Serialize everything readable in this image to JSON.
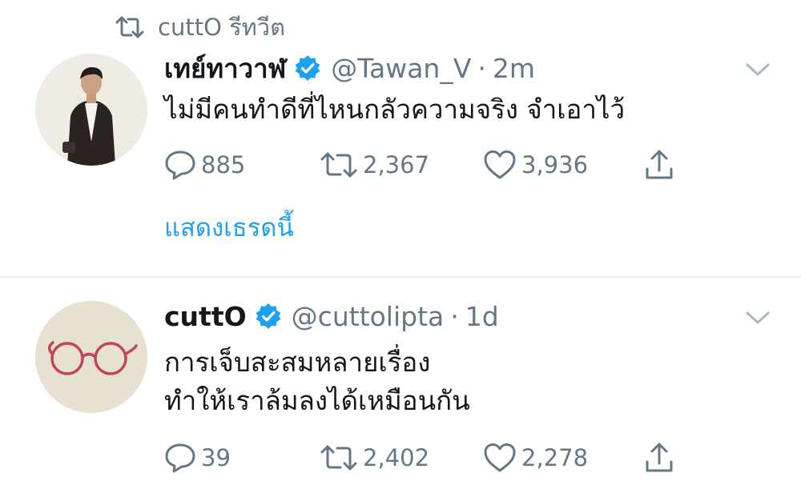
{
  "retweet_context": {
    "text": "cuttO รีทวีต",
    "icon": "retweet-icon"
  },
  "tweets": [
    {
      "author_name": "เทย์ทาวาฬ",
      "handle": "@Tawan_V",
      "time": "2m",
      "verified": true,
      "text_lines": [
        "ไม่มีคนทำดีที่ไหนกลัวความจริง จำเอาไว้"
      ],
      "replies": "885",
      "retweets": "2,367",
      "likes": "3,936",
      "show_thread": "แสดงเธรดนี้"
    },
    {
      "author_name": "cuttO",
      "handle": "@cuttolipta",
      "time": "1d",
      "verified": true,
      "text_lines": [
        "การเจ็บสะสมหลายเรื่อง",
        "ทำให้เราล้มลงได้เหมือนกัน"
      ],
      "replies": "39",
      "retweets": "2,402",
      "likes": "2,278"
    }
  ],
  "colors": {
    "accent": "#1da1f2",
    "muted": "#657786",
    "text": "#14171a",
    "divider": "#e6ecf0",
    "glasses": "#c2435a",
    "avatar2_bg": "#e6e1d0"
  }
}
